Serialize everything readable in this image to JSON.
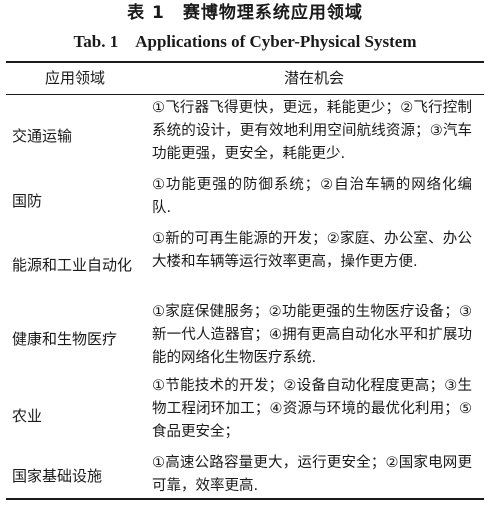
{
  "table": {
    "title_cn": "表 1　赛博物理系统应用领域",
    "title_en": "Tab. 1　Applications of Cyber-Physical System",
    "header": {
      "col1": "应用领域",
      "col2": "潜在机会"
    },
    "rows": [
      {
        "label": "交通运输",
        "text": "①飞行器飞得更快，更远，耗能更少；②飞行控制系统的设计，更有效地利用空间航线资源；③汽车功能更强，更安全，耗能更少."
      },
      {
        "label": "国防",
        "text": "①功能更强的防御系统；②自治车辆的网络化编队."
      },
      {
        "label": "能源和工业自动化",
        "text": "①新的可再生能源的开发；②家庭、办公室、办公大楼和车辆等运行效率更高，操作更方便."
      },
      {
        "label": "健康和生物医疗",
        "text": "①家庭保健服务；②功能更强的生物医疗设备；③新一代人造器官；④拥有更高自动化水平和扩展功能的网络化生物医疗系统."
      },
      {
        "label": "农业",
        "text": "①节能技术的开发；②设备自动化程度更高；③生物工程闭环加工；④资源与环境的最优化利用；⑤食品更安全；"
      },
      {
        "label": "国家基础设施",
        "text": "①高速公路容量更大，运行更安全；②国家电网更可靠，效率更高."
      }
    ]
  }
}
